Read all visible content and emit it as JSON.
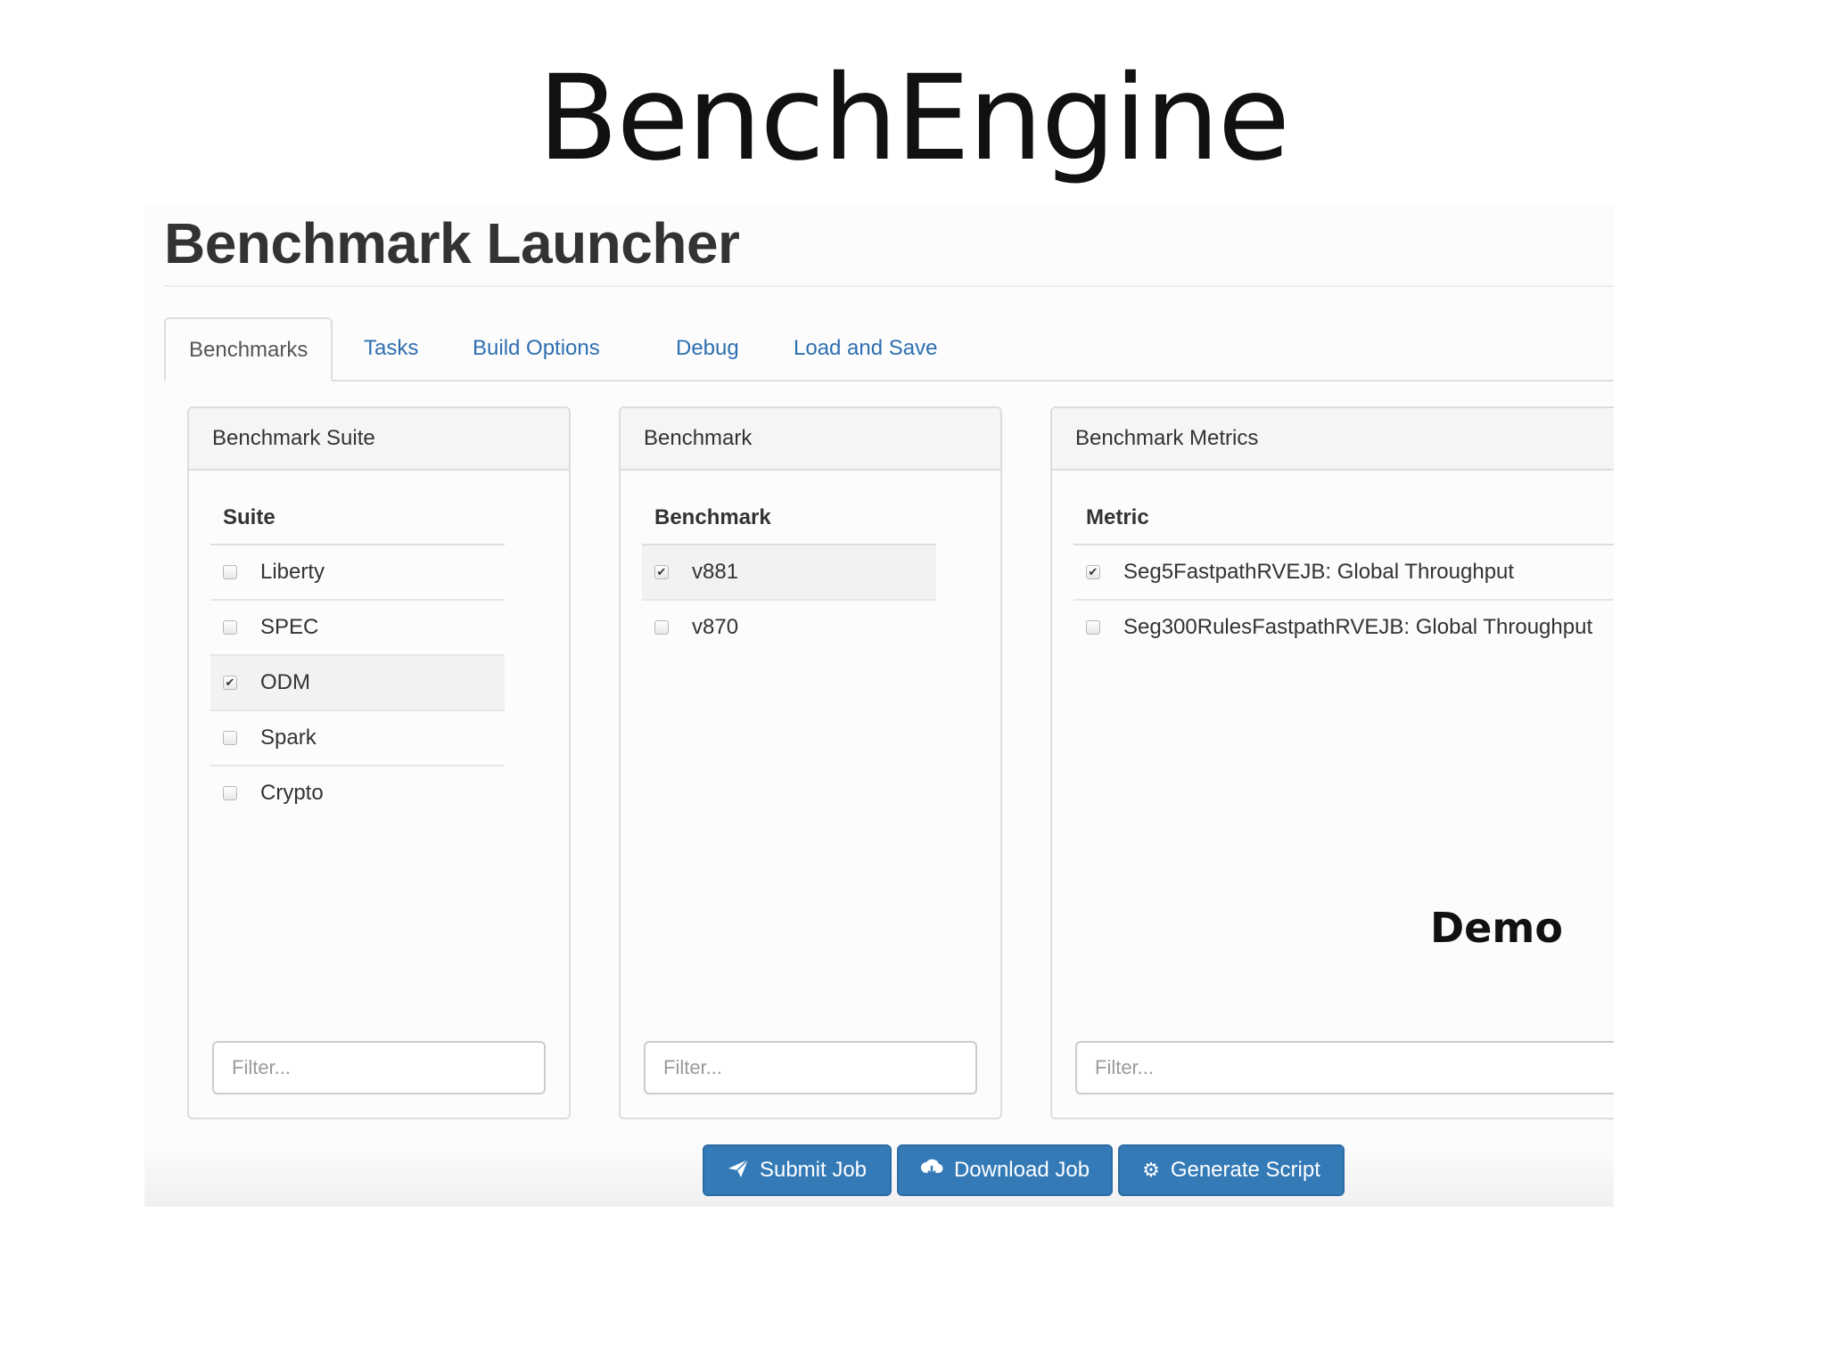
{
  "slide": {
    "title": "BenchEngine",
    "note": "Demo"
  },
  "app": {
    "title": "Benchmark Launcher"
  },
  "tabs": [
    {
      "label": "Benchmarks",
      "active": true
    },
    {
      "label": "Tasks",
      "active": false
    },
    {
      "label": "Build Options",
      "active": false
    },
    {
      "label": "Debug",
      "active": false
    },
    {
      "label": "Load and Save",
      "active": false
    }
  ],
  "panels": {
    "suite": {
      "heading": "Benchmark Suite",
      "column_header": "Suite",
      "items": [
        {
          "label": "Liberty",
          "checked": false
        },
        {
          "label": "SPEC",
          "checked": false
        },
        {
          "label": "ODM",
          "checked": true
        },
        {
          "label": "Spark",
          "checked": false
        },
        {
          "label": "Crypto",
          "checked": false
        }
      ],
      "filter_placeholder": "Filter..."
    },
    "benchmark": {
      "heading": "Benchmark",
      "column_header": "Benchmark",
      "items": [
        {
          "label": "v881",
          "checked": true
        },
        {
          "label": "v870",
          "checked": false
        }
      ],
      "filter_placeholder": "Filter..."
    },
    "metrics": {
      "heading": "Benchmark Metrics",
      "column_header": "Metric",
      "items": [
        {
          "label": "Seg5FastpathRVEJB: Global Throughput",
          "checked": true
        },
        {
          "label": "Seg300RulesFastpathRVEJB: Global Throughput",
          "checked": false
        }
      ],
      "filter_placeholder": "Filter..."
    }
  },
  "actions": {
    "submit_label": "Submit Job",
    "download_label": "Download Job",
    "generate_label": "Generate Script",
    "icons": {
      "submit": "send-icon",
      "download": "cloud-download-icon",
      "generate": "gear-icon"
    },
    "button_color": "#337ab7"
  },
  "colors": {
    "tab_link": "#2e6fb1",
    "panel_heading_bg": "#f5f5f5",
    "border": "#dddddd"
  }
}
